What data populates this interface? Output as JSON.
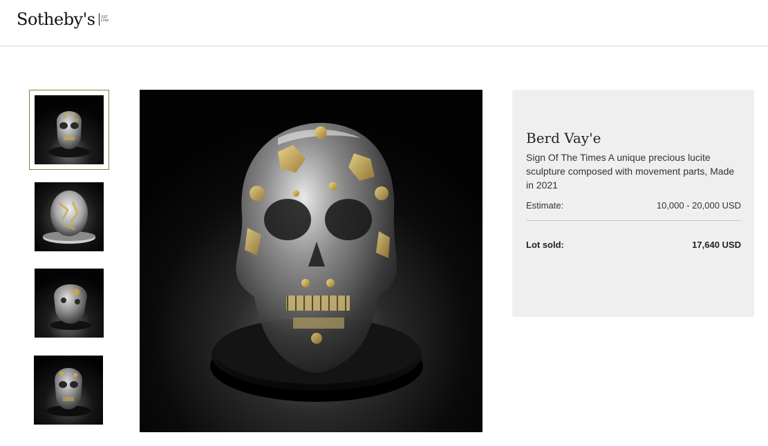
{
  "header": {
    "logo_text": "Sotheby's",
    "logo_est": [
      "EST",
      "1744"
    ]
  },
  "gallery": {
    "thumbnails": [
      {
        "alt": "skull sculpture front view",
        "selected": true
      },
      {
        "alt": "skull sculpture top view",
        "selected": false
      },
      {
        "alt": "skull sculpture three-quarter view",
        "selected": false
      },
      {
        "alt": "skull sculpture front view on base",
        "selected": false
      }
    ],
    "main_alt": "Crystal lucite skull sculpture on black base"
  },
  "lot": {
    "artist": "Berd Vay'e",
    "title": "Sign Of The Times A unique precious lucite sculpture composed with movement parts, Made in 2021",
    "estimate_label": "Estimate:",
    "estimate_value": "10,000 - 20,000 USD",
    "sold_label": "Lot sold:",
    "sold_value": "17,640 USD"
  },
  "colors": {
    "accent_border": "#8b7a3a",
    "panel_bg": "#efefef"
  }
}
